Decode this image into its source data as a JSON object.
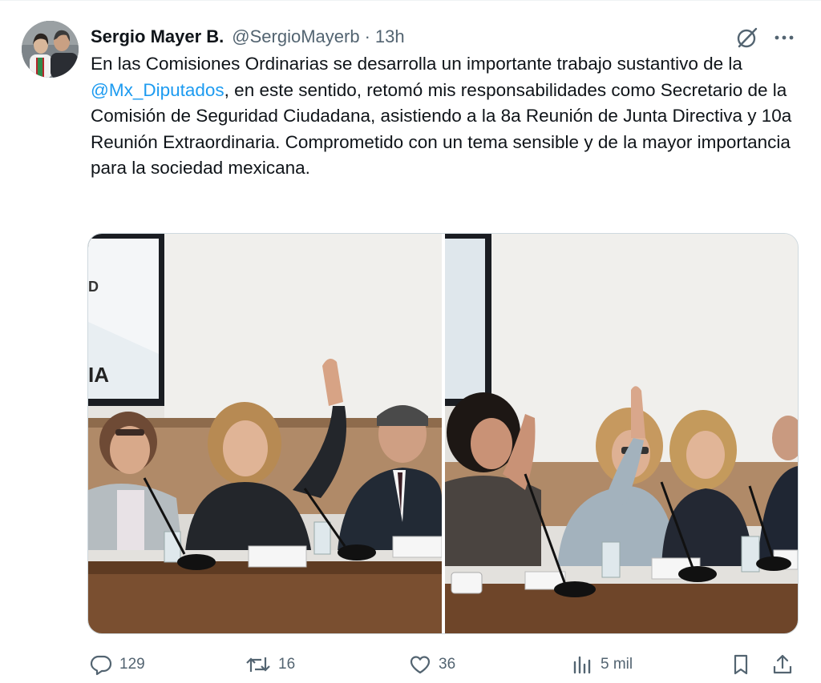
{
  "tweet": {
    "author_name": "Sergio Mayer B.",
    "handle": "@SergioMayerb",
    "separator": "·",
    "time": "13h",
    "text_before": "En las Comisiones Ordinarias se desarrolla un importante trabajo sustantivo de la ",
    "mention": "@Mx_Diputados",
    "text_after": ", en este sentido, retomó mis responsabilidades como Secretario de la Comisión de Seguridad Ciudadana, asistiendo a la 8a Reunión de Junta Directiva y 10a Reunión Extraordinaria. Comprometido con un tema sensible y de la mayor importancia para la sociedad mexicana."
  },
  "media": {
    "left_photo_sign_letters": [
      "D",
      "IA"
    ]
  },
  "actions": {
    "replies": "129",
    "reposts": "16",
    "likes": "36",
    "views": "5 mil"
  },
  "icons": {
    "grok": "grok-icon",
    "more": "more-icon",
    "reply": "reply-icon",
    "repost": "repost-icon",
    "like": "heart-icon",
    "views": "views-icon",
    "bookmark": "bookmark-icon",
    "share": "share-icon"
  },
  "colors": {
    "link": "#1d9bf0",
    "text": "#0f1419",
    "secondary": "#536471"
  }
}
